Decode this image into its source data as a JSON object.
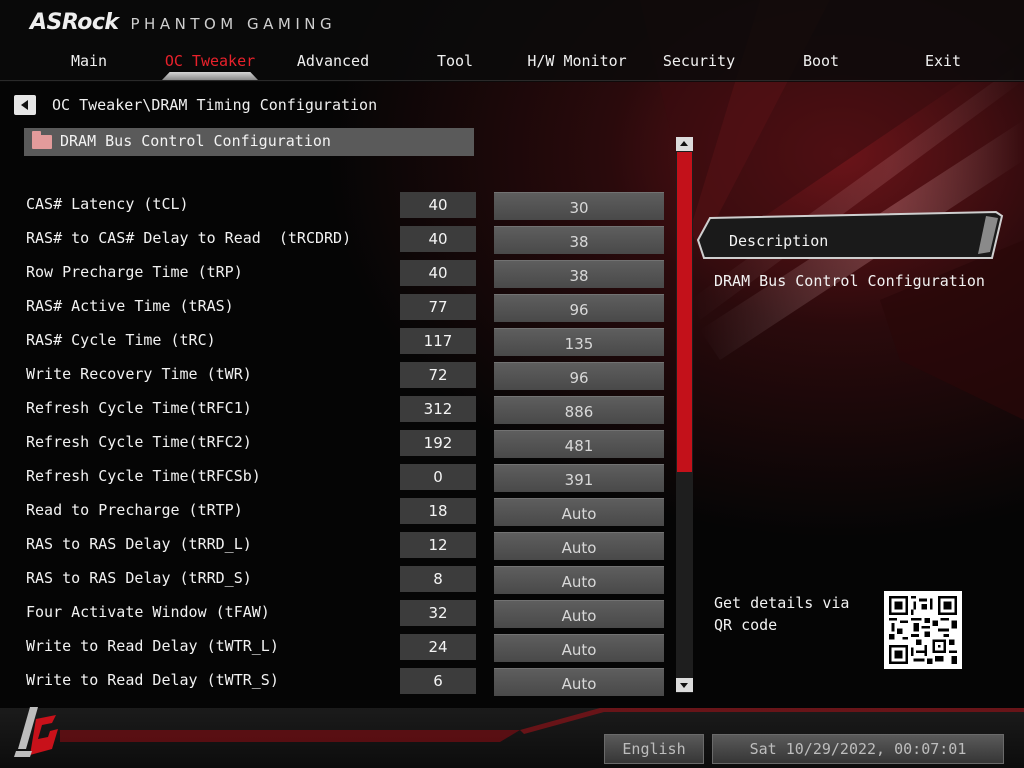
{
  "brand": {
    "name": "ASRock",
    "sub": "PHANTOM GAMING"
  },
  "nav": [
    {
      "label": "Main",
      "active": false
    },
    {
      "label": "OC Tweaker",
      "active": true
    },
    {
      "label": "Advanced",
      "active": false
    },
    {
      "label": "Tool",
      "active": false
    },
    {
      "label": "H/W Monitor",
      "active": false
    },
    {
      "label": "Security",
      "active": false
    },
    {
      "label": "Boot",
      "active": false
    },
    {
      "label": "Exit",
      "active": false
    }
  ],
  "breadcrumb": "OC Tweaker\\DRAM Timing Configuration",
  "section": {
    "label": "DRAM Bus Control Configuration",
    "icon": "folder-icon"
  },
  "rows": [
    {
      "label": "CAS# Latency (tCL)",
      "current": "40",
      "setting": "30"
    },
    {
      "label": "RAS# to CAS# Delay to Read  (tRCDRD)",
      "current": "40",
      "setting": "38"
    },
    {
      "label": "Row Precharge Time (tRP)",
      "current": "40",
      "setting": "38"
    },
    {
      "label": "RAS# Active Time (tRAS)",
      "current": "77",
      "setting": "96"
    },
    {
      "label": "RAS# Cycle Time (tRC)",
      "current": "117",
      "setting": "135"
    },
    {
      "label": "Write Recovery Time (tWR)",
      "current": "72",
      "setting": "96"
    },
    {
      "label": "Refresh Cycle Time(tRFC1)",
      "current": "312",
      "setting": "886"
    },
    {
      "label": "Refresh Cycle Time(tRFC2)",
      "current": "192",
      "setting": "481"
    },
    {
      "label": "Refresh Cycle Time(tRFCSb)",
      "current": "0",
      "setting": "391"
    },
    {
      "label": "Read to Precharge (tRTP)",
      "current": "18",
      "setting": "Auto"
    },
    {
      "label": "RAS to RAS Delay (tRRD_L)",
      "current": "12",
      "setting": "Auto"
    },
    {
      "label": "RAS to RAS Delay (tRRD_S)",
      "current": "8",
      "setting": "Auto"
    },
    {
      "label": "Four Activate Window (tFAW)",
      "current": "32",
      "setting": "Auto"
    },
    {
      "label": "Write to Read Delay (tWTR_L)",
      "current": "24",
      "setting": "Auto"
    },
    {
      "label": "Write to Read Delay (tWTR_S)",
      "current": "6",
      "setting": "Auto"
    }
  ],
  "description": {
    "title": "Description",
    "text": "DRAM Bus Control Configuration"
  },
  "qr": {
    "text": "Get details via QR code"
  },
  "footer": {
    "language": "English",
    "datetime": "Sat 10/29/2022, 00:07:01"
  },
  "colors": {
    "accent": "#e8212b",
    "scroll_thumb": "#c3111a",
    "panel": "#5a5a5a"
  }
}
